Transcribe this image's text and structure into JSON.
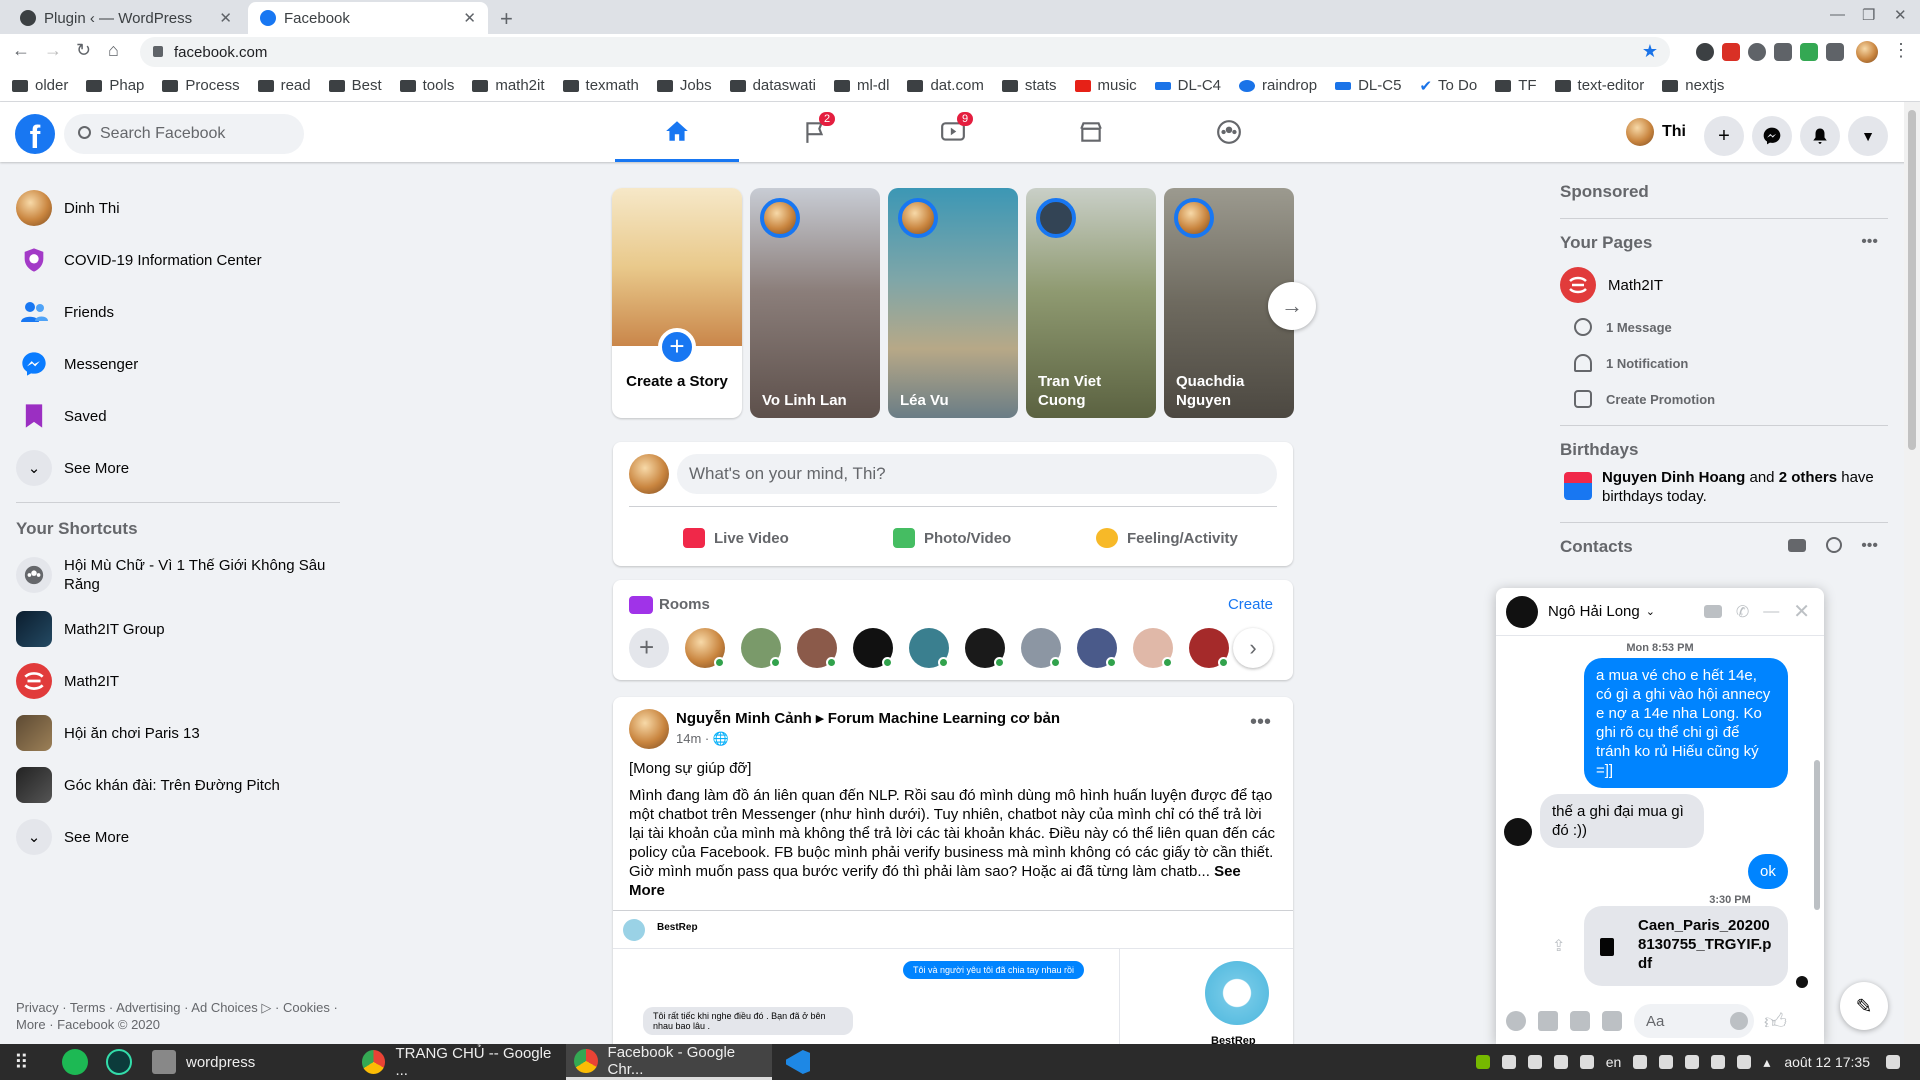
{
  "browser": {
    "tabs": [
      {
        "title": "Plugin ‹ — WordPress"
      },
      {
        "title": "Facebook"
      }
    ],
    "url": "facebook.com",
    "bookmarks": [
      "older",
      "Phap",
      "Process",
      "read",
      "Best",
      "tools",
      "math2it",
      "texmath",
      "Jobs",
      "dataswati",
      "ml-dl",
      "dat.com",
      "stats",
      "music",
      "DL-C4",
      "raindrop",
      "DL-C5",
      "To Do",
      "TF",
      "text-editor",
      "nextjs"
    ],
    "ext_badge": "2"
  },
  "header": {
    "search_placeholder": "Search Facebook",
    "user_name": "Thi",
    "badges": {
      "pages": "2",
      "watch": "9"
    }
  },
  "left": {
    "items": [
      {
        "label": "Dinh Thi"
      },
      {
        "label": "COVID-19 Information Center"
      },
      {
        "label": "Friends"
      },
      {
        "label": "Messenger"
      },
      {
        "label": "Saved"
      },
      {
        "label": "See More"
      }
    ],
    "shortcuts_title": "Your Shortcuts",
    "shortcuts": [
      {
        "label": "Hội Mù Chữ - Vì 1 Thế Giới Không Sâu Răng"
      },
      {
        "label": "Math2IT Group"
      },
      {
        "label": "Math2IT"
      },
      {
        "label": "Hội ăn chơi Paris 13"
      },
      {
        "label": "Góc khán đài: Trên Đường Pitch"
      },
      {
        "label": "See More"
      }
    ],
    "footer": "Privacy · Terms · Advertising · Ad Choices ▷ · Cookies · More · Facebook © 2020"
  },
  "stories": {
    "create_label": "Create a Story",
    "items": [
      {
        "name": "Vo Linh Lan",
        "color": "#7d6a63"
      },
      {
        "name": "Léa Vu",
        "color": "#5a8a9a"
      },
      {
        "name": "Tran Viet Cuong",
        "color": "#6f7a55"
      },
      {
        "name": "Quachdia Nguyen",
        "color": "#8a8270"
      }
    ]
  },
  "composer": {
    "placeholder": "What's on your mind, Thi?",
    "live": "Live Video",
    "photo": "Photo/Video",
    "feeling": "Feeling/Activity"
  },
  "rooms": {
    "title": "Rooms",
    "create": "Create"
  },
  "post": {
    "author": "Nguyễn Minh Cảnh ▸ Forum Machine Learning cơ bản",
    "time": "14m · 🌐",
    "title": "[Mong sự giúp đỡ]",
    "body": "Mình đang làm đồ án liên quan đến NLP. Rồi sau đó mình dùng mô hình huấn luyện được để tạo một chatbot trên Messenger (như hình dưới). Tuy nhiên, chatbot này của mình chỉ có thể trả lời lại tài khoản của mình mà không thể trả lời các tài khoản khác. Điều này có thể liên quan đến các policy của Facebook. FB buộc mình phải verify business mà mình không có các giấy tờ cần thiết. Giờ mình muốn pass qua bước verify đó thì phải làm sao?  Hoặc ai đã từng làm chatb...",
    "see_more": "See More",
    "image": {
      "bot_name": "BestRep",
      "msg_me": "Tôi và người yêu tôi đã chia tay nhau rồi",
      "msg_bot": "Tôi rất tiếc khi nghe điều đó . Bạn đã ở bên nhau bao lâu .",
      "bot_label": "BestRep"
    }
  },
  "right": {
    "sponsored": "Sponsored",
    "your_pages": "Your Pages",
    "page_name": "Math2IT",
    "page_items": [
      "1 Message",
      "1 Notification",
      "Create Promotion"
    ],
    "birthdays_title": "Birthdays",
    "birthday_name": "Nguyen Dinh Hoang",
    "birthday_and": " and ",
    "birthday_others": "2 others",
    "birthday_rest": " have birthdays today.",
    "contacts": "Contacts"
  },
  "chat": {
    "name": "Ngô Hải Long",
    "time1": "Mon 8:53 PM",
    "msg1": "a mua vé cho e hết 14e, có gì a ghi vào hội annecy e nợ a 14e nha Long. Ko ghi rõ cụ thể chi gì để tránh ko rủ Hiếu cũng ký =]]",
    "msg2": "thế a ghi đại mua gì đó :))",
    "msg3": "ok",
    "time2": "3:30 PM",
    "file": "Caen_Paris_202008130755_TRGYIF.pdf",
    "input_placeholder": "Aa"
  },
  "taskbar": {
    "tasks": [
      "wordpress",
      "TRANG CHỦ -- Google ...",
      "Facebook - Google Chr..."
    ],
    "lang": "en",
    "datetime": "août 12  17:35"
  }
}
